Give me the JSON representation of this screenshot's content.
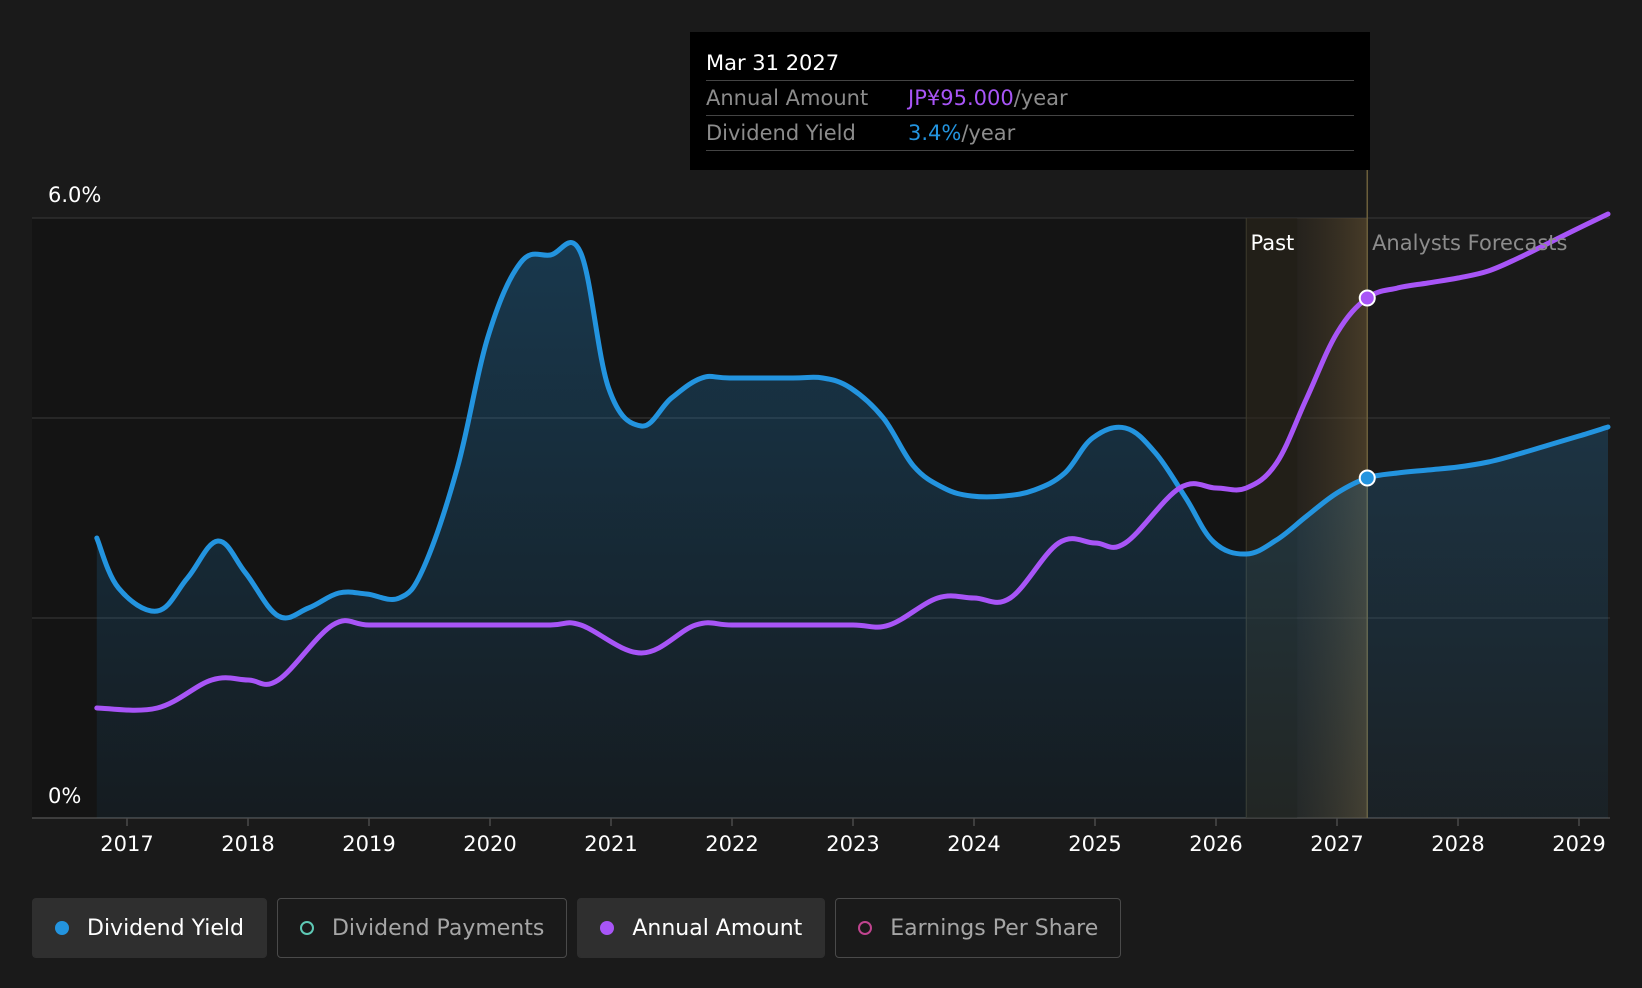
{
  "tooltip": {
    "date": "Mar 31 2027",
    "rows": [
      {
        "label": "Annual Amount",
        "value": "JP¥95.000",
        "unit": "/year",
        "color": "#a855f7"
      },
      {
        "label": "Dividend Yield",
        "value": "3.4%",
        "unit": "/year",
        "color": "#2394df"
      }
    ]
  },
  "legend": [
    {
      "label": "Dividend Yield",
      "color": "#2394df",
      "filled": true,
      "active": true
    },
    {
      "label": "Dividend Payments",
      "color": "#5ec9b5",
      "filled": false,
      "active": false
    },
    {
      "label": "Annual Amount",
      "color": "#a855f7",
      "filled": true,
      "active": true
    },
    {
      "label": "Earnings Per Share",
      "color": "#c0448f",
      "filled": false,
      "active": false
    }
  ],
  "chart_data": {
    "type": "line",
    "y_tick_labels": [
      "6.0%",
      "0%"
    ],
    "ylim": [
      0,
      6.0
    ],
    "xlim": [
      2016.48,
      2029.24
    ],
    "x_tick_labels": [
      "2017",
      "2018",
      "2019",
      "2020",
      "2021",
      "2022",
      "2023",
      "2024",
      "2025",
      "2026",
      "2027",
      "2028",
      "2029"
    ],
    "x_ticks": [
      2017,
      2018,
      2019,
      2020,
      2021,
      2022,
      2023,
      2024,
      2025,
      2026,
      2027,
      2028,
      2029
    ],
    "grid": true,
    "past_label": "Past",
    "forecast_label": "Analysts Forecasts",
    "past_end": 2026.25,
    "forecast_start": 2026.67,
    "cursor_x": 2027.25,
    "series": [
      {
        "name": "Dividend Yield",
        "color": "#2394df",
        "area": true,
        "points": [
          [
            2016.75,
            2.8
          ],
          [
            2016.93,
            2.3
          ],
          [
            2017.25,
            2.07
          ],
          [
            2017.5,
            2.4
          ],
          [
            2017.75,
            2.77
          ],
          [
            2017.98,
            2.45
          ],
          [
            2018.25,
            2.02
          ],
          [
            2018.5,
            2.1
          ],
          [
            2018.75,
            2.25
          ],
          [
            2018.98,
            2.24
          ],
          [
            2019.25,
            2.2
          ],
          [
            2019.45,
            2.5
          ],
          [
            2019.73,
            3.5
          ],
          [
            2019.98,
            4.8
          ],
          [
            2020.25,
            5.55
          ],
          [
            2020.5,
            5.63
          ],
          [
            2020.75,
            5.65
          ],
          [
            2020.98,
            4.3
          ],
          [
            2021.25,
            3.92
          ],
          [
            2021.5,
            4.2
          ],
          [
            2021.75,
            4.4
          ],
          [
            2021.98,
            4.4
          ],
          [
            2022.5,
            4.4
          ],
          [
            2022.75,
            4.4
          ],
          [
            2022.98,
            4.3
          ],
          [
            2023.25,
            4.0
          ],
          [
            2023.5,
            3.52
          ],
          [
            2023.75,
            3.3
          ],
          [
            2023.98,
            3.22
          ],
          [
            2024.25,
            3.22
          ],
          [
            2024.5,
            3.28
          ],
          [
            2024.75,
            3.45
          ],
          [
            2024.98,
            3.8
          ],
          [
            2025.25,
            3.9
          ],
          [
            2025.5,
            3.65
          ],
          [
            2025.75,
            3.2
          ],
          [
            2025.98,
            2.76
          ],
          [
            2026.25,
            2.64
          ],
          [
            2026.5,
            2.78
          ],
          [
            2026.75,
            3.02
          ],
          [
            2027.0,
            3.25
          ],
          [
            2027.25,
            3.4
          ],
          [
            2027.5,
            3.45
          ],
          [
            2027.75,
            3.48
          ],
          [
            2028.0,
            3.51
          ],
          [
            2028.25,
            3.56
          ],
          [
            2028.5,
            3.64
          ],
          [
            2028.75,
            3.73
          ],
          [
            2029.0,
            3.82
          ],
          [
            2029.24,
            3.91
          ]
        ]
      },
      {
        "name": "Annual Amount",
        "color": "#a855f7",
        "area": false,
        "points": [
          [
            2016.75,
            1.1
          ],
          [
            2017.25,
            1.1
          ],
          [
            2017.7,
            1.38
          ],
          [
            2018.0,
            1.38
          ],
          [
            2018.25,
            1.38
          ],
          [
            2018.7,
            1.93
          ],
          [
            2019.0,
            1.93
          ],
          [
            2019.5,
            1.93
          ],
          [
            2020.0,
            1.93
          ],
          [
            2020.5,
            1.93
          ],
          [
            2020.75,
            1.93
          ],
          [
            2021.25,
            1.65
          ],
          [
            2021.7,
            1.93
          ],
          [
            2022.0,
            1.93
          ],
          [
            2022.5,
            1.93
          ],
          [
            2023.0,
            1.93
          ],
          [
            2023.3,
            1.93
          ],
          [
            2023.7,
            2.2
          ],
          [
            2024.0,
            2.2
          ],
          [
            2024.3,
            2.2
          ],
          [
            2024.7,
            2.75
          ],
          [
            2025.0,
            2.75
          ],
          [
            2025.25,
            2.75
          ],
          [
            2025.7,
            3.3
          ],
          [
            2026.0,
            3.3
          ],
          [
            2026.25,
            3.3
          ],
          [
            2026.5,
            3.55
          ],
          [
            2026.75,
            4.2
          ],
          [
            2027.0,
            4.85
          ],
          [
            2027.25,
            5.2
          ],
          [
            2027.5,
            5.3
          ],
          [
            2027.75,
            5.35
          ],
          [
            2028.0,
            5.4
          ],
          [
            2028.25,
            5.47
          ],
          [
            2028.5,
            5.6
          ],
          [
            2028.75,
            5.75
          ],
          [
            2029.0,
            5.9
          ],
          [
            2029.24,
            6.04
          ]
        ]
      }
    ],
    "markers": [
      {
        "x": 2027.25,
        "y": 5.2,
        "color": "#a855f7"
      },
      {
        "x": 2027.25,
        "y": 3.4,
        "color": "#2394df"
      }
    ]
  }
}
